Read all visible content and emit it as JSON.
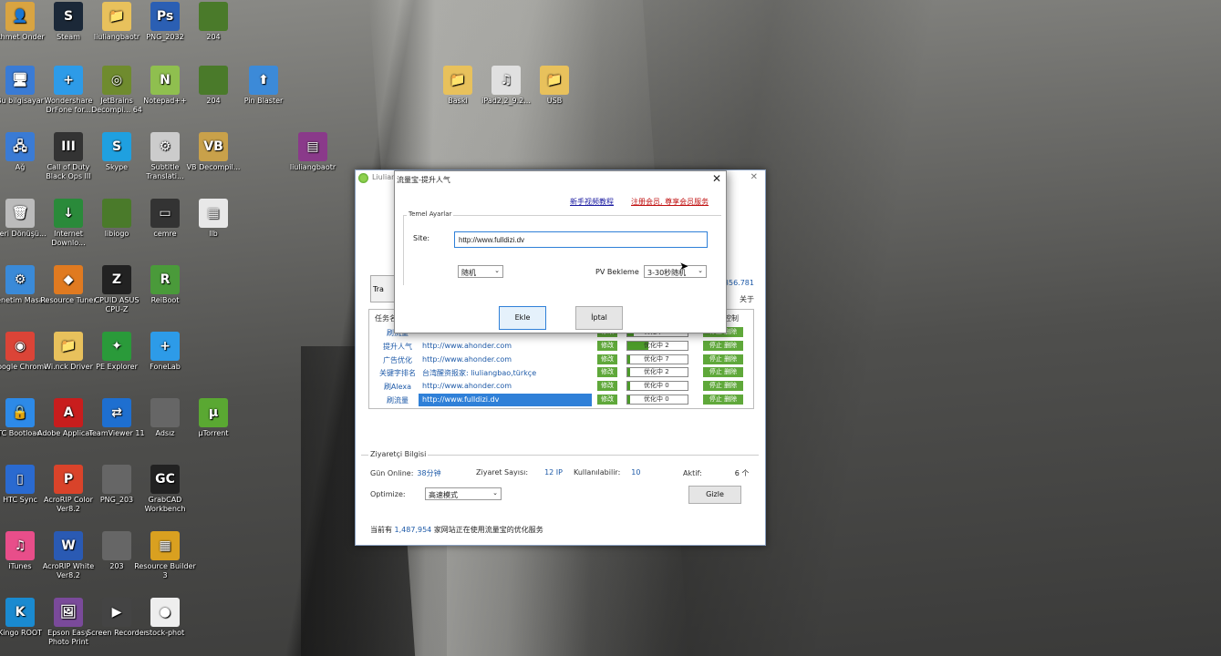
{
  "desktop": {
    "icons": [
      {
        "label": "Ahmet Onder",
        "color": "#d9a441",
        "glyph": "👤"
      },
      {
        "label": "Steam",
        "color": "#1b2838",
        "glyph": "S"
      },
      {
        "label": "liuliangbaotr",
        "color": "#e8c15c",
        "glyph": "📁"
      },
      {
        "label": "PNG_2032",
        "color": "#2b5fb3",
        "glyph": "Ps"
      },
      {
        "label": "204",
        "color": "#4a7a2a",
        "glyph": ""
      },
      {
        "label": "Bu bilgisayar",
        "color": "#3a7bd5",
        "glyph": "🖥"
      },
      {
        "label": "Wondershare DrFone for...",
        "color": "#2d9be8",
        "glyph": "+"
      },
      {
        "label": "JetBrains Decompi... 64 Free",
        "color": "#6f8b2e",
        "glyph": "◎"
      },
      {
        "label": "Notepad++",
        "color": "#8fbf4f",
        "glyph": "N"
      },
      {
        "label": "204",
        "color": "#4a7a2a",
        "glyph": ""
      },
      {
        "label": "Pin Blaster",
        "color": "#3c8ad8",
        "glyph": "⬆"
      },
      {
        "label": "Baski",
        "color": "#e8c15c",
        "glyph": "📁"
      },
      {
        "label": "iPad2,2_9.2...",
        "color": "#e0e0e0",
        "glyph": "♫"
      },
      {
        "label": "USB",
        "color": "#e8c15c",
        "glyph": "📁"
      },
      {
        "label": "Ağ",
        "color": "#3a7bd5",
        "glyph": "🖧"
      },
      {
        "label": "Call of Duty Black Ops III",
        "color": "#333",
        "glyph": "III"
      },
      {
        "label": "Skype",
        "color": "#1fa0e0",
        "glyph": "S"
      },
      {
        "label": "Subtitle Translati...",
        "color": "#ccc",
        "glyph": "⚙"
      },
      {
        "label": "VB Decompil...",
        "color": "#c9a14a",
        "glyph": "VB"
      },
      {
        "label": "liuliangbaotr",
        "color": "#8a3a8a",
        "glyph": "▤"
      },
      {
        "label": "Geri Dönüşü...",
        "color": "#bbb",
        "glyph": "🗑"
      },
      {
        "label": "Internet Downlo...",
        "color": "#2a8a3a",
        "glyph": "↓"
      },
      {
        "label": "libiogo",
        "color": "#4a7a2a",
        "glyph": ""
      },
      {
        "label": "cemre",
        "color": "#333",
        "glyph": "▭"
      },
      {
        "label": "llb",
        "color": "#e8e8e8",
        "glyph": "▦"
      },
      {
        "label": "Denetim Masası",
        "color": "#3a8ad8",
        "glyph": "⚙"
      },
      {
        "label": "Resource Tuner",
        "color": "#e07a20",
        "glyph": "◆"
      },
      {
        "label": "CPUID ASUS CPU-Z",
        "color": "#222",
        "glyph": "Z"
      },
      {
        "label": "ReiBoot",
        "color": "#4a9a3a",
        "glyph": "R"
      },
      {
        "label": "Google Chrome",
        "color": "#db4437",
        "glyph": "◉"
      },
      {
        "label": "Wi.nck Driver",
        "color": "#e8c15c",
        "glyph": "📁"
      },
      {
        "label": "PE Explorer",
        "color": "#2a9a3a",
        "glyph": "✦"
      },
      {
        "label": "FoneLab",
        "color": "#2d9be8",
        "glyph": "+"
      },
      {
        "label": "HTC Bootload...",
        "color": "#2d8ae8",
        "glyph": "🔒"
      },
      {
        "label": "Adobe Applicat...",
        "color": "#c81d1d",
        "glyph": "A"
      },
      {
        "label": "TeamViewer 11",
        "color": "#1e6fd0",
        "glyph": "⇄"
      },
      {
        "label": "Adsız",
        "color": "#666",
        "glyph": ""
      },
      {
        "label": "µTorrent",
        "color": "#5aa832",
        "glyph": "µ"
      },
      {
        "label": "HTC Sync",
        "color": "#2a6ad0",
        "glyph": "▯"
      },
      {
        "label": "AcroRIP Color Ver8.2",
        "color": "#d9432a",
        "glyph": "P"
      },
      {
        "label": "PNG_203",
        "color": "#666",
        "glyph": ""
      },
      {
        "label": "GrabCAD Workbench",
        "color": "#222",
        "glyph": "GC"
      },
      {
        "label": "iTunes",
        "color": "#e84e8a",
        "glyph": "♫"
      },
      {
        "label": "AcroRIP White Ver8.2",
        "color": "#2a5ab3",
        "glyph": "W"
      },
      {
        "label": "203",
        "color": "#666",
        "glyph": ""
      },
      {
        "label": "Resource Builder 3",
        "color": "#d9a020",
        "glyph": "▦"
      },
      {
        "label": "Kingo ROOT",
        "color": "#1a8ad0",
        "glyph": "K"
      },
      {
        "label": "Epson Easy Photo Print",
        "color": "#7a4a9a",
        "glyph": "🖼"
      },
      {
        "label": "Screen Recorder",
        "color": "#444",
        "glyph": "▶"
      },
      {
        "label": "stock-phot",
        "color": "#eee",
        "glyph": "●"
      }
    ]
  },
  "main_window": {
    "title": "Liuliang",
    "close_glyph": "✕",
    "traffic_button": "Tra",
    "stat_number": "356.781",
    "about_label": "关于",
    "task_header": "任务名",
    "control_header": "控制",
    "rows": [
      {
        "name": "刷流量",
        "url": "",
        "mod": "修改",
        "status": "优化中 0",
        "ctl": "停止 删除",
        "fill": 0.1
      },
      {
        "name": "提升人气",
        "url": "http://www.ahonder.com",
        "mod": "修改",
        "status": "优化中 2",
        "ctl": "停止 删除",
        "fill": 0.35
      },
      {
        "name": "广告优化",
        "url": "http://www.ahonder.com",
        "mod": "修改",
        "status": "优化中 7",
        "ctl": "停止 删除",
        "fill": 0.05
      },
      {
        "name": "关键字排名",
        "url": "台湾醒资报家: liuliangbao,türkçe",
        "mod": "修改",
        "status": "优化中 2",
        "ctl": "停止 删除",
        "fill": 0.05
      },
      {
        "name": "刷Alexa",
        "url": "http://www.ahonder.com",
        "mod": "修改",
        "status": "优化中 0",
        "ctl": "停止 删除",
        "fill": 0.05
      },
      {
        "name": "刷流量",
        "url": "http://www.fulldizi.dv",
        "mod": "修改",
        "status": "优化中 0",
        "ctl": "停止 删除",
        "fill": 0.05
      }
    ],
    "visit_info": {
      "title": "Ziyaretçi Bilgisi",
      "online_label": "Gün Online:",
      "online_value": "38分钟",
      "visits_label": "Ziyaret Sayısı:",
      "visits_value": "12 IP",
      "available_label": "Kullanılabilir:",
      "available_value": "10",
      "active_label": "Aktif:",
      "active_value": "6 个",
      "optimize_label": "Optimize:",
      "optimize_value": "高速模式",
      "hide_button": "Gizle"
    },
    "footer_prefix": "当前有",
    "footer_number": "1,487,954",
    "footer_suffix": "家网站正在使用流量宝的优化服务"
  },
  "dialog": {
    "title": "流量宝-提升人气",
    "close_glyph": "✕",
    "link_tutorial": "新手视频教程",
    "link_register": "注册会员, 尊享会员服务",
    "group_title": "Temel Ayarlar",
    "site_label": "Site:",
    "site_value": "http://www.fulldizi.dv",
    "random_select": "随机",
    "pv_label": "PV Bekleme",
    "pv_select": "3-30秒随机",
    "ok_button": "Ekle",
    "cancel_button": "İptal"
  },
  "colors": {
    "accent_green": "#5fa83a",
    "link_blue": "#1e5aa8",
    "selection_blue": "#2f80d8"
  }
}
